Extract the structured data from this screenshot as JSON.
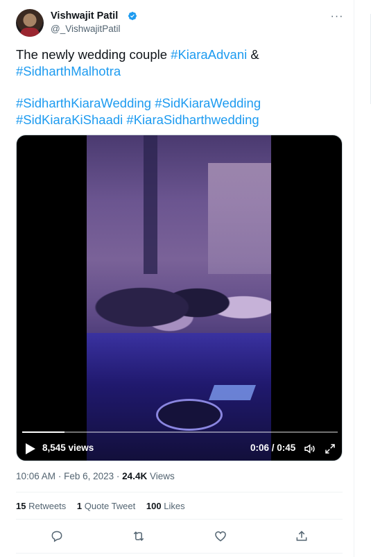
{
  "author": {
    "display_name": "Vishwajit Patil",
    "handle": "@_VishwajitPatil",
    "verified": true
  },
  "more_menu_label": "···",
  "tweet": {
    "line1_text": "The newly wedding couple ",
    "line1_tag": "#KiaraAdvani",
    "line1_after": " &",
    "line2_tag": "#SidharthMalhotra",
    "line3_tag_a": "#SidharthKiaraWedding",
    "line3_tag_b": "#SidKiaraWedding",
    "line4_tag_a": "#SidKiaraKiShaadi",
    "line4_tag_b": "#KiaraSidharthwedding"
  },
  "video": {
    "views_label": "8,545 views",
    "time_current": "0:06",
    "time_total": "0:45",
    "time_separator": " / ",
    "progress_fraction": 0.133
  },
  "meta": {
    "time": "10:06 AM",
    "separator": "·",
    "date": "Feb 6, 2023",
    "views_count": "24.4K",
    "views_label": "Views"
  },
  "stats": {
    "retweets_count": "15",
    "retweets_label": "Retweets",
    "quotes_count": "1",
    "quotes_label": "Quote Tweet",
    "likes_count": "100",
    "likes_label": "Likes"
  },
  "colors": {
    "accent": "#1d9bf0",
    "text_primary": "#0f1419",
    "text_secondary": "#536471"
  },
  "icons": [
    "verified-badge-icon",
    "more-icon",
    "play-icon",
    "volume-icon",
    "fullscreen-icon",
    "reply-icon",
    "retweet-icon",
    "like-icon",
    "share-icon"
  ]
}
